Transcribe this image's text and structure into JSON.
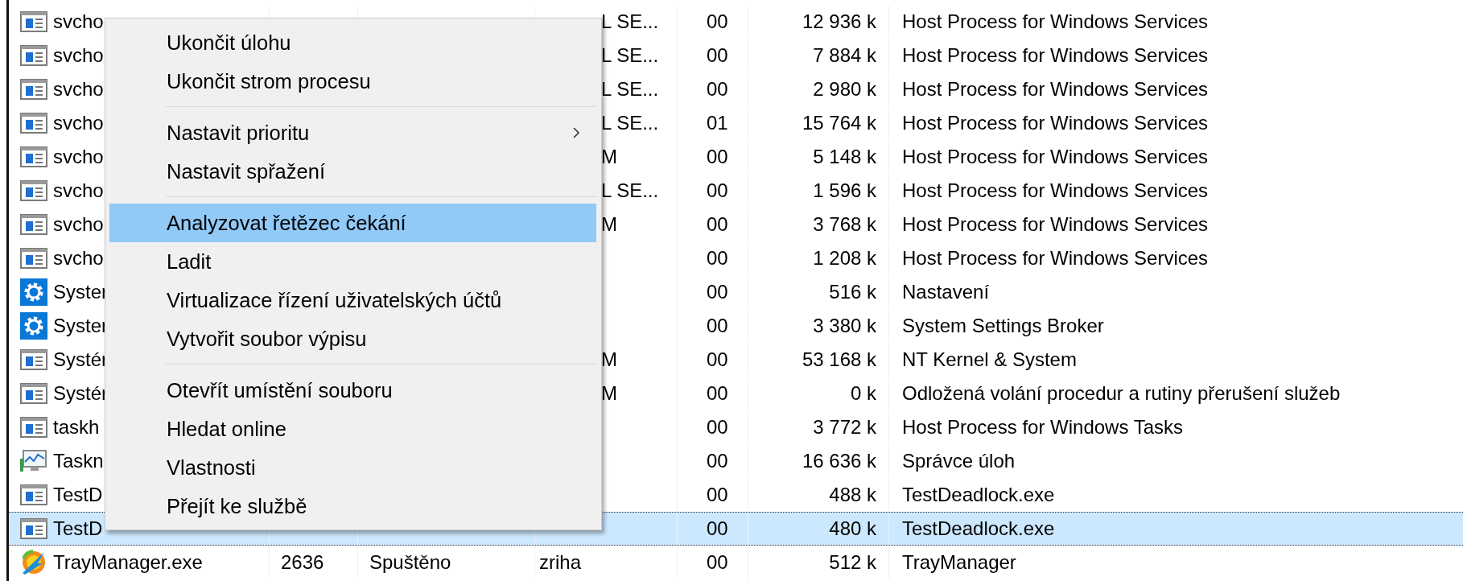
{
  "processes": [
    {
      "kind": "window",
      "name": "svcho",
      "user": "L SE...",
      "cpu": "00",
      "memory": "12 936 k",
      "description": "Host Process for Windows Services",
      "selected": false
    },
    {
      "kind": "window",
      "name": "svcho",
      "user": "L SE...",
      "cpu": "00",
      "memory": "7 884 k",
      "description": "Host Process for Windows Services",
      "selected": false
    },
    {
      "kind": "window",
      "name": "svcho",
      "user": "L SE...",
      "cpu": "00",
      "memory": "2 980 k",
      "description": "Host Process for Windows Services",
      "selected": false
    },
    {
      "kind": "window",
      "name": "svcho",
      "user": "L SE...",
      "cpu": "01",
      "memory": "15 764 k",
      "description": "Host Process for Windows Services",
      "selected": false
    },
    {
      "kind": "window",
      "name": "svcho",
      "user": "M",
      "cpu": "00",
      "memory": "5 148 k",
      "description": "Host Process for Windows Services",
      "selected": false
    },
    {
      "kind": "window",
      "name": "svcho",
      "user": "L SE...",
      "cpu": "00",
      "memory": "1 596 k",
      "description": "Host Process for Windows Services",
      "selected": false
    },
    {
      "kind": "window",
      "name": "svcho",
      "user": "M",
      "cpu": "00",
      "memory": "3 768 k",
      "description": "Host Process for Windows Services",
      "selected": false
    },
    {
      "kind": "window",
      "name": "svcho",
      "cpu": "00",
      "memory": "1 208 k",
      "description": "Host Process for Windows Services",
      "selected": false
    },
    {
      "kind": "gear",
      "name": "Syster",
      "cpu": "00",
      "memory": "516 k",
      "description": "Nastavení",
      "selected": false
    },
    {
      "kind": "gear",
      "name": "Syster",
      "cpu": "00",
      "memory": "3 380 k",
      "description": "System Settings Broker",
      "selected": false
    },
    {
      "kind": "window",
      "name": "Systér",
      "user": "M",
      "cpu": "00",
      "memory": "53 168 k",
      "description": "NT Kernel & System",
      "selected": false
    },
    {
      "kind": "window",
      "name": "Systér",
      "user": "M",
      "cpu": "00",
      "memory": "0 k",
      "description": "Odložená volání procedur a rutiny přerušení služeb",
      "selected": false
    },
    {
      "kind": "window",
      "name": "taskh",
      "cpu": "00",
      "memory": "3 772 k",
      "description": "Host Process for Windows Tasks",
      "selected": false
    },
    {
      "kind": "monitor",
      "name": "Taskn",
      "cpu": "00",
      "memory": "16 636 k",
      "description": "Správce úloh",
      "selected": false
    },
    {
      "kind": "window",
      "name": "TestD",
      "cpu": "00",
      "memory": "488 k",
      "description": "TestDeadlock.exe",
      "selected": false
    },
    {
      "kind": "window",
      "name": "TestD",
      "cpu": "00",
      "memory": "480 k",
      "description": "TestDeadlock.exe",
      "selected": true
    },
    {
      "kind": "tray",
      "name": "TrayManager.exe",
      "pid": "2636",
      "status": "Spuštěno",
      "user": "zriha",
      "cpu": "00",
      "memory": "512 k",
      "description": "TrayManager",
      "selected": false
    }
  ],
  "context_menu": {
    "items": [
      {
        "kind": "item",
        "label": "Ukončit úlohu",
        "selected": false,
        "submenu": false
      },
      {
        "kind": "item",
        "label": "Ukončit strom procesu",
        "selected": false,
        "submenu": false
      },
      {
        "kind": "separator"
      },
      {
        "kind": "item",
        "label": "Nastavit prioritu",
        "selected": false,
        "submenu": true
      },
      {
        "kind": "item",
        "label": "Nastavit spřažení",
        "selected": false,
        "submenu": false
      },
      {
        "kind": "separator"
      },
      {
        "kind": "item",
        "label": "Analyzovat řetězec čekání",
        "selected": true,
        "submenu": false
      },
      {
        "kind": "item",
        "label": "Ladit",
        "selected": false,
        "submenu": false
      },
      {
        "kind": "item",
        "label": "Virtualizace řízení uživatelských účtů",
        "selected": false,
        "submenu": false
      },
      {
        "kind": "item",
        "label": "Vytvořit soubor výpisu",
        "selected": false,
        "submenu": false
      },
      {
        "kind": "separator"
      },
      {
        "kind": "item",
        "label": "Otevřít umístění souboru",
        "selected": false,
        "submenu": false
      },
      {
        "kind": "item",
        "label": "Hledat online",
        "selected": false,
        "submenu": false
      },
      {
        "kind": "item",
        "label": "Vlastnosti",
        "selected": false,
        "submenu": false
      },
      {
        "kind": "item",
        "label": "Přejít ke službě",
        "selected": false,
        "submenu": false
      }
    ]
  }
}
